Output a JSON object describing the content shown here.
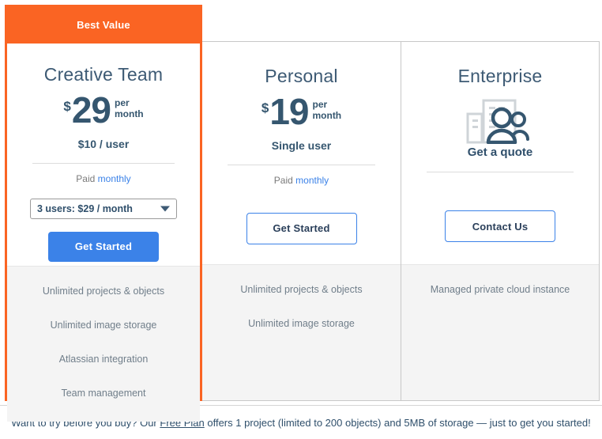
{
  "featured_badge": "Best Value",
  "plans": [
    {
      "name": "Creative Team",
      "currency": "$",
      "amount": "29",
      "per_line1": "per",
      "per_line2": "month",
      "sub_price": "$10 / user",
      "paid_prefix": "Paid ",
      "paid_period": "monthly",
      "select_value": "3 users: $29 / month",
      "cta": "Get Started",
      "features": [
        "Unlimited projects & objects",
        "Unlimited image storage",
        "Atlassian integration",
        "Team management"
      ]
    },
    {
      "name": "Personal",
      "currency": "$",
      "amount": "19",
      "per_line1": "per",
      "per_line2": "month",
      "sub_price": "Single user",
      "paid_prefix": "Paid ",
      "paid_period": "monthly",
      "cta": "Get Started",
      "features": [
        "Unlimited projects & objects",
        "Unlimited image storage"
      ]
    },
    {
      "name": "Enterprise",
      "icon": "building-people-icon",
      "quote_text": "Get a quote",
      "cta": "Contact Us",
      "features": [
        "Managed private cloud instance"
      ]
    }
  ],
  "footer": {
    "part1": "Want to try before you buy? Our ",
    "link": "Free Plan",
    "part2": " offers 1 project (limited to 200 objects) and 5MB of storage — just to get you started!"
  },
  "colors": {
    "accent_orange": "#fa6423",
    "primary_blue": "#3b82e8",
    "navy": "#35566f",
    "feature_bg": "#f4f4f4"
  }
}
